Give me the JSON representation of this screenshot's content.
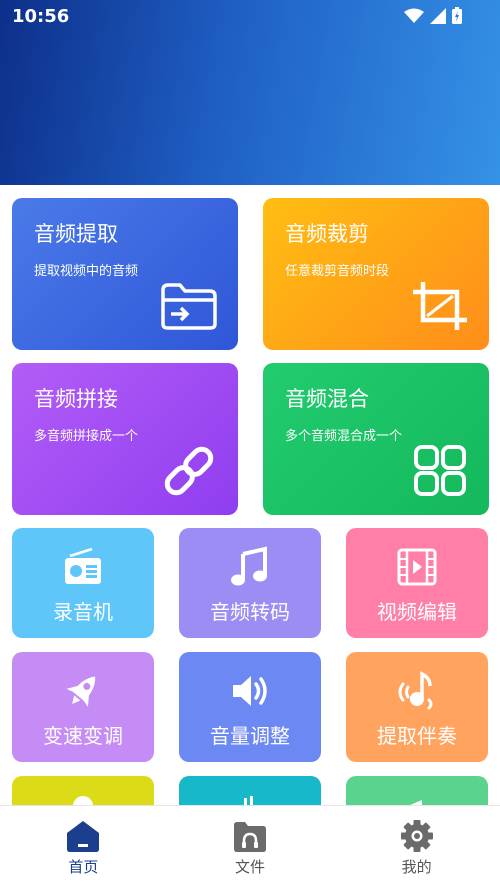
{
  "status": {
    "time": "10:56"
  },
  "big_cards": [
    {
      "title": "音频提取",
      "subtitle": "提取视频中的音频",
      "icon": "folder-import-icon",
      "color_start": "#4b7ae8",
      "color_end": "#2f56d8"
    },
    {
      "title": "音频裁剪",
      "subtitle": "任意裁剪音频时段",
      "icon": "crop-icon",
      "color_start": "#ffbe12",
      "color_end": "#ff8d1a"
    },
    {
      "title": "音频拼接",
      "subtitle": "多音频拼接成一个",
      "icon": "link-icon",
      "color_start": "#b35cf7",
      "color_end": "#8f3ef0"
    },
    {
      "title": "音频混合",
      "subtitle": "多个音频混合成一个",
      "icon": "apps-grid-icon",
      "color_start": "#22cc6f",
      "color_end": "#15b85c"
    }
  ],
  "small_cards": [
    {
      "label": "录音机",
      "icon": "radio-icon",
      "color": "#5fc6fa"
    },
    {
      "label": "音频转码",
      "icon": "music-note-icon",
      "color": "#9a8df3"
    },
    {
      "label": "视频编辑",
      "icon": "film-icon",
      "color": "#ff7fa6"
    },
    {
      "label": "变速变调",
      "icon": "rocket-icon",
      "color": "#c58cf6"
    },
    {
      "label": "音量调整",
      "icon": "volume-icon",
      "color": "#6c88f3"
    },
    {
      "label": "提取伴奏",
      "icon": "music-signal-icon",
      "color": "#ffa35e"
    }
  ],
  "partial_cards": [
    {
      "color": "#dcdb18"
    },
    {
      "color": "#16b8ca"
    },
    {
      "color": "#5ad38e"
    }
  ],
  "nav": {
    "items": [
      {
        "label": "首页",
        "icon": "home-icon",
        "active": true
      },
      {
        "label": "文件",
        "icon": "folder-headphones-icon",
        "active": false
      },
      {
        "label": "我的",
        "icon": "gear-icon",
        "active": false
      }
    ],
    "active_color": "#1b3f8c",
    "inactive_color": "#555555"
  }
}
